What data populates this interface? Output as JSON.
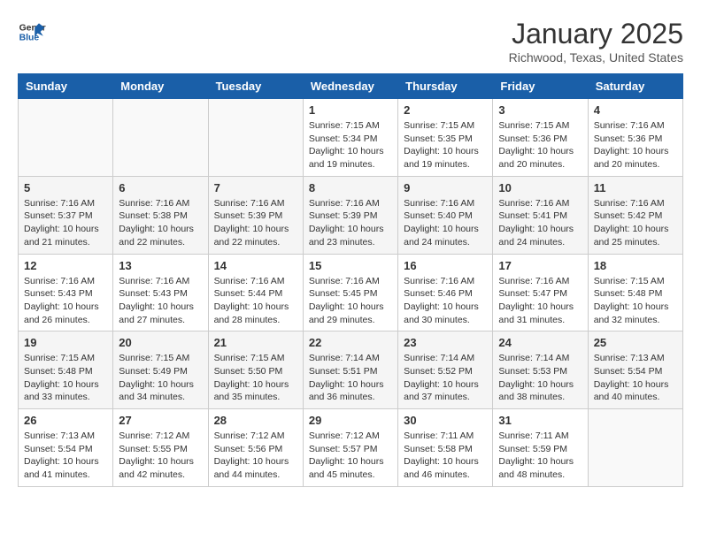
{
  "logo": {
    "name1": "General",
    "name2": "Blue"
  },
  "title": "January 2025",
  "location": "Richwood, Texas, United States",
  "days_of_week": [
    "Sunday",
    "Monday",
    "Tuesday",
    "Wednesday",
    "Thursday",
    "Friday",
    "Saturday"
  ],
  "weeks": [
    [
      {
        "day": null
      },
      {
        "day": null
      },
      {
        "day": null
      },
      {
        "day": "1",
        "sunrise": "Sunrise: 7:15 AM",
        "sunset": "Sunset: 5:34 PM",
        "daylight": "Daylight: 10 hours and 19 minutes."
      },
      {
        "day": "2",
        "sunrise": "Sunrise: 7:15 AM",
        "sunset": "Sunset: 5:35 PM",
        "daylight": "Daylight: 10 hours and 19 minutes."
      },
      {
        "day": "3",
        "sunrise": "Sunrise: 7:15 AM",
        "sunset": "Sunset: 5:36 PM",
        "daylight": "Daylight: 10 hours and 20 minutes."
      },
      {
        "day": "4",
        "sunrise": "Sunrise: 7:16 AM",
        "sunset": "Sunset: 5:36 PM",
        "daylight": "Daylight: 10 hours and 20 minutes."
      }
    ],
    [
      {
        "day": "5",
        "sunrise": "Sunrise: 7:16 AM",
        "sunset": "Sunset: 5:37 PM",
        "daylight": "Daylight: 10 hours and 21 minutes."
      },
      {
        "day": "6",
        "sunrise": "Sunrise: 7:16 AM",
        "sunset": "Sunset: 5:38 PM",
        "daylight": "Daylight: 10 hours and 22 minutes."
      },
      {
        "day": "7",
        "sunrise": "Sunrise: 7:16 AM",
        "sunset": "Sunset: 5:39 PM",
        "daylight": "Daylight: 10 hours and 22 minutes."
      },
      {
        "day": "8",
        "sunrise": "Sunrise: 7:16 AM",
        "sunset": "Sunset: 5:39 PM",
        "daylight": "Daylight: 10 hours and 23 minutes."
      },
      {
        "day": "9",
        "sunrise": "Sunrise: 7:16 AM",
        "sunset": "Sunset: 5:40 PM",
        "daylight": "Daylight: 10 hours and 24 minutes."
      },
      {
        "day": "10",
        "sunrise": "Sunrise: 7:16 AM",
        "sunset": "Sunset: 5:41 PM",
        "daylight": "Daylight: 10 hours and 24 minutes."
      },
      {
        "day": "11",
        "sunrise": "Sunrise: 7:16 AM",
        "sunset": "Sunset: 5:42 PM",
        "daylight": "Daylight: 10 hours and 25 minutes."
      }
    ],
    [
      {
        "day": "12",
        "sunrise": "Sunrise: 7:16 AM",
        "sunset": "Sunset: 5:43 PM",
        "daylight": "Daylight: 10 hours and 26 minutes."
      },
      {
        "day": "13",
        "sunrise": "Sunrise: 7:16 AM",
        "sunset": "Sunset: 5:43 PM",
        "daylight": "Daylight: 10 hours and 27 minutes."
      },
      {
        "day": "14",
        "sunrise": "Sunrise: 7:16 AM",
        "sunset": "Sunset: 5:44 PM",
        "daylight": "Daylight: 10 hours and 28 minutes."
      },
      {
        "day": "15",
        "sunrise": "Sunrise: 7:16 AM",
        "sunset": "Sunset: 5:45 PM",
        "daylight": "Daylight: 10 hours and 29 minutes."
      },
      {
        "day": "16",
        "sunrise": "Sunrise: 7:16 AM",
        "sunset": "Sunset: 5:46 PM",
        "daylight": "Daylight: 10 hours and 30 minutes."
      },
      {
        "day": "17",
        "sunrise": "Sunrise: 7:16 AM",
        "sunset": "Sunset: 5:47 PM",
        "daylight": "Daylight: 10 hours and 31 minutes."
      },
      {
        "day": "18",
        "sunrise": "Sunrise: 7:15 AM",
        "sunset": "Sunset: 5:48 PM",
        "daylight": "Daylight: 10 hours and 32 minutes."
      }
    ],
    [
      {
        "day": "19",
        "sunrise": "Sunrise: 7:15 AM",
        "sunset": "Sunset: 5:48 PM",
        "daylight": "Daylight: 10 hours and 33 minutes."
      },
      {
        "day": "20",
        "sunrise": "Sunrise: 7:15 AM",
        "sunset": "Sunset: 5:49 PM",
        "daylight": "Daylight: 10 hours and 34 minutes."
      },
      {
        "day": "21",
        "sunrise": "Sunrise: 7:15 AM",
        "sunset": "Sunset: 5:50 PM",
        "daylight": "Daylight: 10 hours and 35 minutes."
      },
      {
        "day": "22",
        "sunrise": "Sunrise: 7:14 AM",
        "sunset": "Sunset: 5:51 PM",
        "daylight": "Daylight: 10 hours and 36 minutes."
      },
      {
        "day": "23",
        "sunrise": "Sunrise: 7:14 AM",
        "sunset": "Sunset: 5:52 PM",
        "daylight": "Daylight: 10 hours and 37 minutes."
      },
      {
        "day": "24",
        "sunrise": "Sunrise: 7:14 AM",
        "sunset": "Sunset: 5:53 PM",
        "daylight": "Daylight: 10 hours and 38 minutes."
      },
      {
        "day": "25",
        "sunrise": "Sunrise: 7:13 AM",
        "sunset": "Sunset: 5:54 PM",
        "daylight": "Daylight: 10 hours and 40 minutes."
      }
    ],
    [
      {
        "day": "26",
        "sunrise": "Sunrise: 7:13 AM",
        "sunset": "Sunset: 5:54 PM",
        "daylight": "Daylight: 10 hours and 41 minutes."
      },
      {
        "day": "27",
        "sunrise": "Sunrise: 7:12 AM",
        "sunset": "Sunset: 5:55 PM",
        "daylight": "Daylight: 10 hours and 42 minutes."
      },
      {
        "day": "28",
        "sunrise": "Sunrise: 7:12 AM",
        "sunset": "Sunset: 5:56 PM",
        "daylight": "Daylight: 10 hours and 44 minutes."
      },
      {
        "day": "29",
        "sunrise": "Sunrise: 7:12 AM",
        "sunset": "Sunset: 5:57 PM",
        "daylight": "Daylight: 10 hours and 45 minutes."
      },
      {
        "day": "30",
        "sunrise": "Sunrise: 7:11 AM",
        "sunset": "Sunset: 5:58 PM",
        "daylight": "Daylight: 10 hours and 46 minutes."
      },
      {
        "day": "31",
        "sunrise": "Sunrise: 7:11 AM",
        "sunset": "Sunset: 5:59 PM",
        "daylight": "Daylight: 10 hours and 48 minutes."
      },
      {
        "day": null
      }
    ]
  ]
}
